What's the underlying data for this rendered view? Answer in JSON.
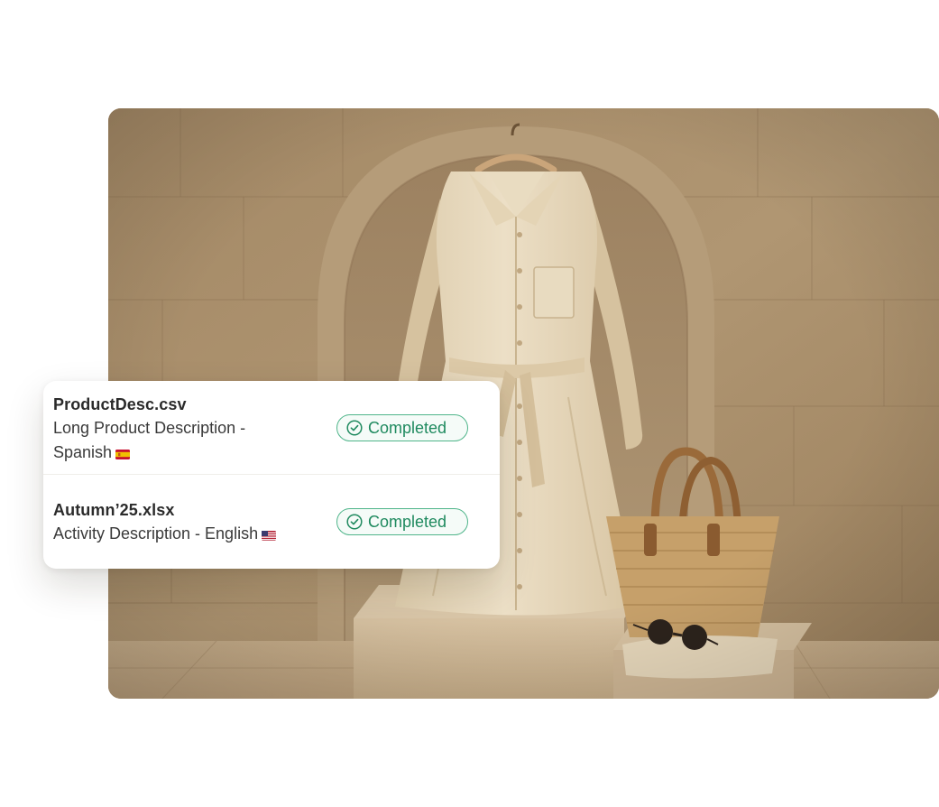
{
  "jobs": [
    {
      "file_name": "ProductDesc.csv",
      "description": "Long Product Description - Spanish",
      "flag_icon": "spain-flag-icon",
      "status": "Completed"
    },
    {
      "file_name": "Autumn’25.xlsx",
      "description": "Activity Description - English",
      "flag_icon": "us-flag-icon",
      "status": "Completed"
    }
  ],
  "colors": {
    "status_text": "#1f8a5f",
    "status_border": "#4fb58a",
    "card_background": "#ffffff",
    "stone_wall": "#a88d6a"
  }
}
